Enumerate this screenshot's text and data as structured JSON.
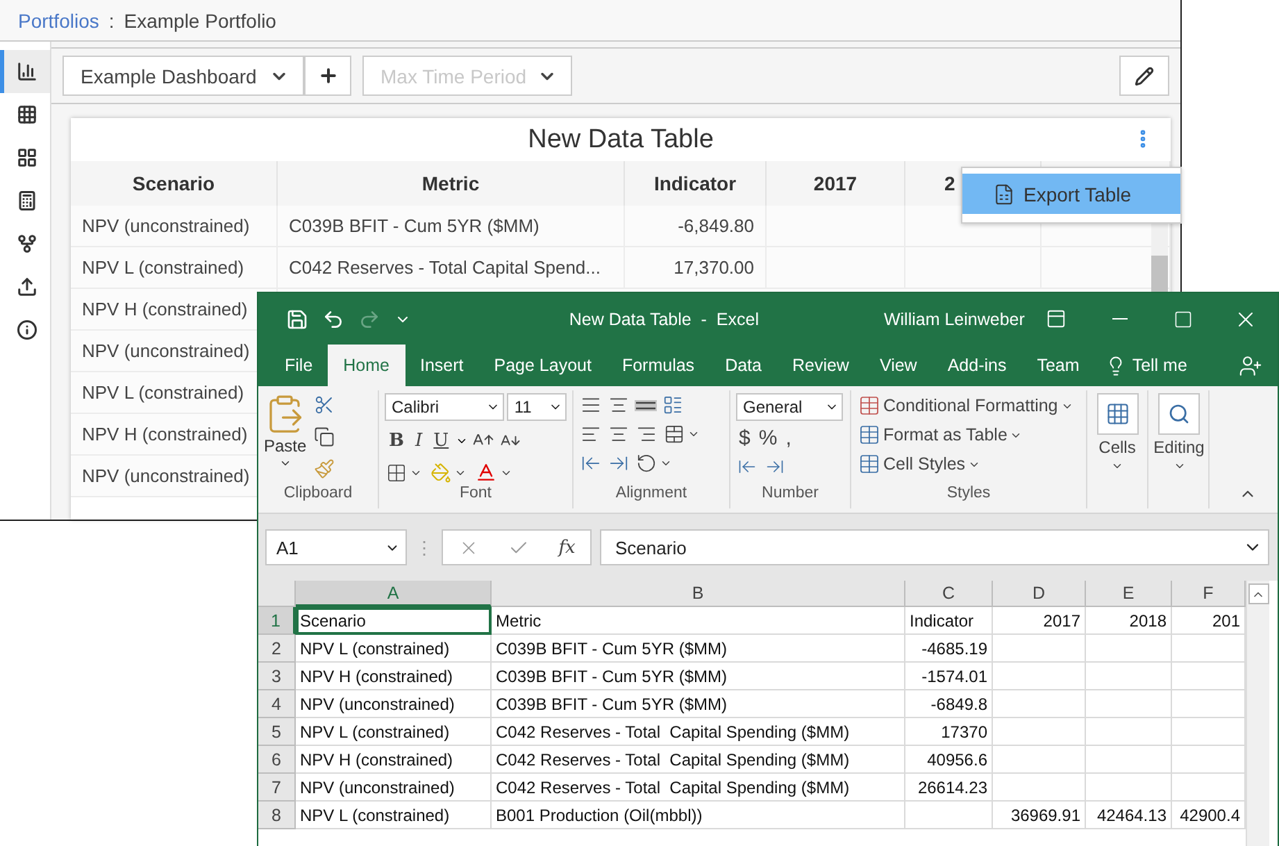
{
  "app": {
    "breadcrumb": {
      "parent": "Portfolios",
      "separator": ":",
      "current": "Example Portfolio"
    },
    "sidebar": [
      {
        "kind": "chart",
        "selected": true
      },
      {
        "kind": "grid",
        "selected": false
      },
      {
        "kind": "tiles",
        "selected": false
      },
      {
        "kind": "calculator",
        "selected": false
      },
      {
        "kind": "fork",
        "selected": false
      },
      {
        "kind": "upload",
        "selected": false
      },
      {
        "kind": "info",
        "selected": false
      }
    ],
    "toolbar": {
      "dashboard": "Example Dashboard",
      "time_period": {
        "label": "Max Time Period",
        "disabled": true
      }
    },
    "card": {
      "title": "New Data Table",
      "columns": [
        "Scenario",
        "Metric",
        "Indicator",
        "2017",
        "2"
      ],
      "rows": [
        {
          "scenario": "NPV (unconstrained)",
          "metric": "C039B BFIT - Cum 5YR ($MM)",
          "indicator": "-6,849.80"
        },
        {
          "scenario": "NPV L (constrained)",
          "metric": "C042 Reserves - Total Capital Spend...",
          "indicator": "17,370.00"
        },
        {
          "scenario": "NPV H (constrained)"
        },
        {
          "scenario": "NPV (unconstrained)"
        },
        {
          "scenario": "NPV L (constrained)"
        },
        {
          "scenario": "NPV H (constrained)"
        },
        {
          "scenario": "NPV (unconstrained)"
        }
      ],
      "menu": [
        {
          "label": "Export Table",
          "selected": true
        }
      ]
    }
  },
  "excel": {
    "quick_access": {
      "redo_disabled": true
    },
    "title": "New Data Table  -  Excel",
    "user": "William Leinweber",
    "tabs": [
      {
        "label": "File",
        "selected": false
      },
      {
        "label": "Home",
        "selected": true
      },
      {
        "label": "Insert",
        "selected": false
      },
      {
        "label": "Page Layout",
        "selected": false
      },
      {
        "label": "Formulas",
        "selected": false
      },
      {
        "label": "Data",
        "selected": false
      },
      {
        "label": "Review",
        "selected": false
      },
      {
        "label": "View",
        "selected": false
      },
      {
        "label": "Add-ins",
        "selected": false
      },
      {
        "label": "Team",
        "selected": false
      }
    ],
    "tell_me": "Tell me",
    "ribbon": {
      "clipboard": {
        "label": "Clipboard",
        "paste": "Paste"
      },
      "font": {
        "label": "Font",
        "name": "Calibri",
        "size": "11",
        "styles": [
          "B",
          "I",
          "U"
        ]
      },
      "alignment": {
        "label": "Alignment",
        "bottom_align_on": true
      },
      "number": {
        "label": "Number",
        "format": "General",
        "symbols": [
          "$",
          "%",
          ","
        ]
      },
      "styles": {
        "label": "Styles",
        "items": [
          "Conditional Formatting",
          "Format as Table",
          "Cell Styles"
        ]
      },
      "cells": "Cells",
      "editing": "Editing"
    },
    "formula_bar": {
      "name_box": "A1",
      "separator": "⋮",
      "function_label": "fx",
      "formula": "Scenario"
    },
    "columns": [
      {
        "label": "A",
        "selected": true
      },
      {
        "label": "B",
        "selected": false
      },
      {
        "label": "C",
        "selected": false
      },
      {
        "label": "D",
        "selected": false
      },
      {
        "label": "E",
        "selected": false
      },
      {
        "label": "F",
        "selected": false
      }
    ],
    "rows": [
      {
        "number": "1",
        "kind": "header",
        "selected": true,
        "cells": [
          "Scenario",
          "Metric",
          "Indicator",
          "2017",
          "2018",
          "201"
        ]
      },
      {
        "number": "2",
        "kind": "data",
        "selected": false,
        "cells": [
          "NPV L (constrained)",
          "C039B BFIT - Cum 5YR ($MM)",
          "-4685.19",
          "",
          "",
          ""
        ]
      },
      {
        "number": "3",
        "kind": "data",
        "selected": false,
        "cells": [
          "NPV H (constrained)",
          "C039B BFIT - Cum 5YR ($MM)",
          "-1574.01",
          "",
          "",
          ""
        ]
      },
      {
        "number": "4",
        "kind": "data",
        "selected": false,
        "cells": [
          "NPV (unconstrained)",
          "C039B BFIT - Cum 5YR ($MM)",
          "-6849.8",
          "",
          "",
          ""
        ]
      },
      {
        "number": "5",
        "kind": "data",
        "selected": false,
        "cells": [
          "NPV L (constrained)",
          "C042 Reserves - Total  Capital Spending ($MM)",
          "17370",
          "",
          "",
          ""
        ]
      },
      {
        "number": "6",
        "kind": "data",
        "selected": false,
        "cells": [
          "NPV H (constrained)",
          "C042 Reserves - Total  Capital Spending ($MM)",
          "40956.6",
          "",
          "",
          ""
        ]
      },
      {
        "number": "7",
        "kind": "data",
        "selected": false,
        "cells": [
          "NPV (unconstrained)",
          "C042 Reserves - Total  Capital Spending ($MM)",
          "26614.23",
          "",
          "",
          ""
        ]
      },
      {
        "number": "8",
        "kind": "data",
        "selected": false,
        "cells": [
          "NPV L (constrained)",
          "B001 Production (Oil(mbbl))",
          "",
          "36969.91",
          "42464.13",
          "42900.4"
        ]
      }
    ]
  }
}
